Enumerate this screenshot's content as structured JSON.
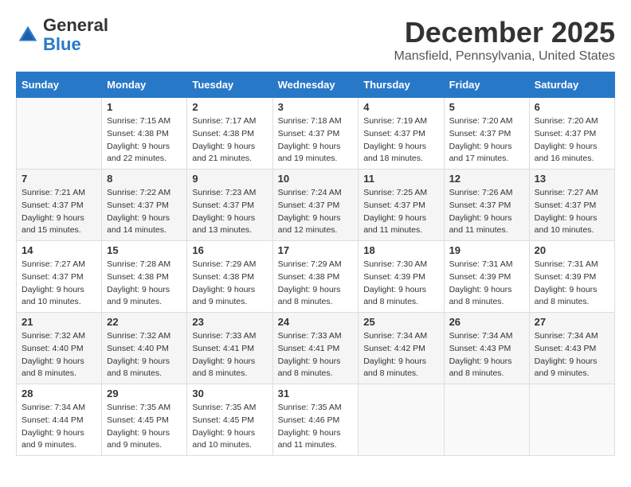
{
  "header": {
    "logo_line1": "General",
    "logo_line2": "Blue",
    "month_title": "December 2025",
    "location": "Mansfield, Pennsylvania, United States"
  },
  "days_of_week": [
    "Sunday",
    "Monday",
    "Tuesday",
    "Wednesday",
    "Thursday",
    "Friday",
    "Saturday"
  ],
  "weeks": [
    [
      {
        "day": "",
        "info": ""
      },
      {
        "day": "1",
        "info": "Sunrise: 7:15 AM\nSunset: 4:38 PM\nDaylight: 9 hours\nand 22 minutes."
      },
      {
        "day": "2",
        "info": "Sunrise: 7:17 AM\nSunset: 4:38 PM\nDaylight: 9 hours\nand 21 minutes."
      },
      {
        "day": "3",
        "info": "Sunrise: 7:18 AM\nSunset: 4:37 PM\nDaylight: 9 hours\nand 19 minutes."
      },
      {
        "day": "4",
        "info": "Sunrise: 7:19 AM\nSunset: 4:37 PM\nDaylight: 9 hours\nand 18 minutes."
      },
      {
        "day": "5",
        "info": "Sunrise: 7:20 AM\nSunset: 4:37 PM\nDaylight: 9 hours\nand 17 minutes."
      },
      {
        "day": "6",
        "info": "Sunrise: 7:20 AM\nSunset: 4:37 PM\nDaylight: 9 hours\nand 16 minutes."
      }
    ],
    [
      {
        "day": "7",
        "info": "Sunrise: 7:21 AM\nSunset: 4:37 PM\nDaylight: 9 hours\nand 15 minutes."
      },
      {
        "day": "8",
        "info": "Sunrise: 7:22 AM\nSunset: 4:37 PM\nDaylight: 9 hours\nand 14 minutes."
      },
      {
        "day": "9",
        "info": "Sunrise: 7:23 AM\nSunset: 4:37 PM\nDaylight: 9 hours\nand 13 minutes."
      },
      {
        "day": "10",
        "info": "Sunrise: 7:24 AM\nSunset: 4:37 PM\nDaylight: 9 hours\nand 12 minutes."
      },
      {
        "day": "11",
        "info": "Sunrise: 7:25 AM\nSunset: 4:37 PM\nDaylight: 9 hours\nand 11 minutes."
      },
      {
        "day": "12",
        "info": "Sunrise: 7:26 AM\nSunset: 4:37 PM\nDaylight: 9 hours\nand 11 minutes."
      },
      {
        "day": "13",
        "info": "Sunrise: 7:27 AM\nSunset: 4:37 PM\nDaylight: 9 hours\nand 10 minutes."
      }
    ],
    [
      {
        "day": "14",
        "info": "Sunrise: 7:27 AM\nSunset: 4:37 PM\nDaylight: 9 hours\nand 10 minutes."
      },
      {
        "day": "15",
        "info": "Sunrise: 7:28 AM\nSunset: 4:38 PM\nDaylight: 9 hours\nand 9 minutes."
      },
      {
        "day": "16",
        "info": "Sunrise: 7:29 AM\nSunset: 4:38 PM\nDaylight: 9 hours\nand 9 minutes."
      },
      {
        "day": "17",
        "info": "Sunrise: 7:29 AM\nSunset: 4:38 PM\nDaylight: 9 hours\nand 8 minutes."
      },
      {
        "day": "18",
        "info": "Sunrise: 7:30 AM\nSunset: 4:39 PM\nDaylight: 9 hours\nand 8 minutes."
      },
      {
        "day": "19",
        "info": "Sunrise: 7:31 AM\nSunset: 4:39 PM\nDaylight: 9 hours\nand 8 minutes."
      },
      {
        "day": "20",
        "info": "Sunrise: 7:31 AM\nSunset: 4:39 PM\nDaylight: 9 hours\nand 8 minutes."
      }
    ],
    [
      {
        "day": "21",
        "info": "Sunrise: 7:32 AM\nSunset: 4:40 PM\nDaylight: 9 hours\nand 8 minutes."
      },
      {
        "day": "22",
        "info": "Sunrise: 7:32 AM\nSunset: 4:40 PM\nDaylight: 9 hours\nand 8 minutes."
      },
      {
        "day": "23",
        "info": "Sunrise: 7:33 AM\nSunset: 4:41 PM\nDaylight: 9 hours\nand 8 minutes."
      },
      {
        "day": "24",
        "info": "Sunrise: 7:33 AM\nSunset: 4:41 PM\nDaylight: 9 hours\nand 8 minutes."
      },
      {
        "day": "25",
        "info": "Sunrise: 7:34 AM\nSunset: 4:42 PM\nDaylight: 9 hours\nand 8 minutes."
      },
      {
        "day": "26",
        "info": "Sunrise: 7:34 AM\nSunset: 4:43 PM\nDaylight: 9 hours\nand 8 minutes."
      },
      {
        "day": "27",
        "info": "Sunrise: 7:34 AM\nSunset: 4:43 PM\nDaylight: 9 hours\nand 9 minutes."
      }
    ],
    [
      {
        "day": "28",
        "info": "Sunrise: 7:34 AM\nSunset: 4:44 PM\nDaylight: 9 hours\nand 9 minutes."
      },
      {
        "day": "29",
        "info": "Sunrise: 7:35 AM\nSunset: 4:45 PM\nDaylight: 9 hours\nand 9 minutes."
      },
      {
        "day": "30",
        "info": "Sunrise: 7:35 AM\nSunset: 4:45 PM\nDaylight: 9 hours\nand 10 minutes."
      },
      {
        "day": "31",
        "info": "Sunrise: 7:35 AM\nSunset: 4:46 PM\nDaylight: 9 hours\nand 11 minutes."
      },
      {
        "day": "",
        "info": ""
      },
      {
        "day": "",
        "info": ""
      },
      {
        "day": "",
        "info": ""
      }
    ]
  ]
}
